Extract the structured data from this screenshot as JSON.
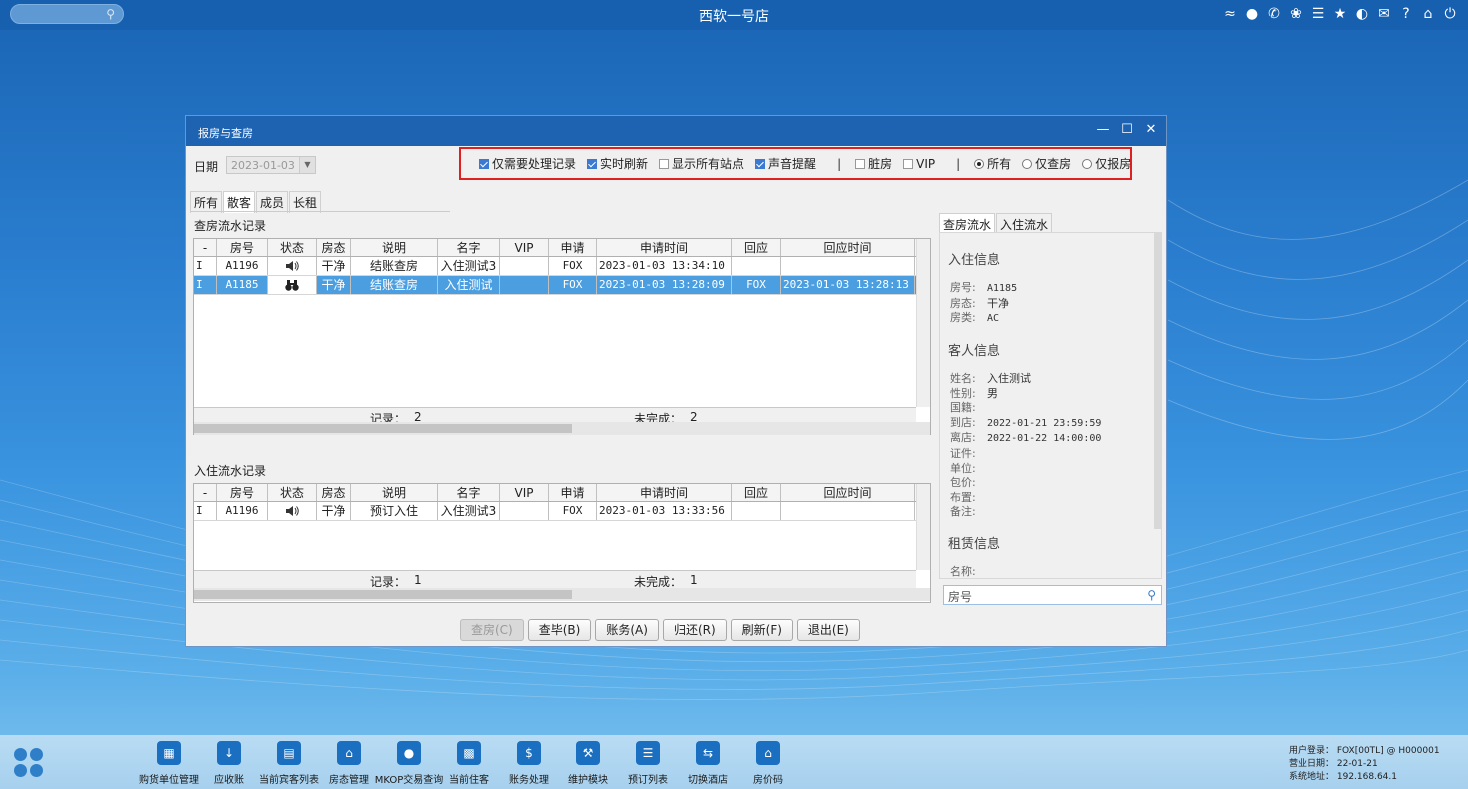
{
  "app_title": "西软一号店",
  "dialog": {
    "title": "报房与查房",
    "minimize": "—",
    "maximize": "☐",
    "close": "✕"
  },
  "date": {
    "label": "日期",
    "value": "2023-01-03"
  },
  "filters": {
    "only_pending": {
      "label": "仅需要处理记录",
      "checked": true
    },
    "realtime": {
      "label": "实时刷新",
      "checked": true
    },
    "all_stations": {
      "label": "显示所有站点",
      "checked": false
    },
    "sound": {
      "label": "声音提醒",
      "checked": true
    },
    "dirty": {
      "label": "脏房",
      "checked": false
    },
    "vip": {
      "label": "VIP",
      "checked": false
    },
    "sep": "|",
    "radio_all": {
      "label": "所有",
      "selected": true
    },
    "radio_check": {
      "label": "仅查房",
      "selected": false
    },
    "radio_report": {
      "label": "仅报房",
      "selected": false
    }
  },
  "tabs": [
    "所有",
    "散客",
    "成员",
    "长租"
  ],
  "inspect_section": {
    "label": "查房流水记录",
    "columns": [
      "-",
      "房号",
      "状态",
      "房态",
      "说明",
      "名字",
      "VIP",
      "申请",
      "申请时间",
      "回应",
      "回应时间"
    ],
    "rows": [
      {
        "flag": "I",
        "room": "A1196",
        "status_icon": "speaker-icon",
        "state": "干净",
        "desc": "结账查房",
        "name": "入住测试3",
        "vip": "",
        "apply": "FOX",
        "apply_time": "2023-01-03 13:34:10",
        "reply": "",
        "reply_time": ""
      },
      {
        "flag": "I",
        "room": "A1185",
        "status_icon": "binoculars-icon",
        "state": "干净",
        "desc": "结账查房",
        "name": "入住测试",
        "vip": "",
        "apply": "FOX",
        "apply_time": "2023-01-03 13:28:09",
        "reply": "FOX",
        "reply_time": "2023-01-03 13:28:13"
      }
    ],
    "footer": {
      "records_label": "记录：",
      "records": "2",
      "unfinished_label": "未完成：",
      "unfinished": "2"
    }
  },
  "checkin_section": {
    "label": "入住流水记录",
    "rows": [
      {
        "flag": "I",
        "room": "A1196",
        "status_icon": "speaker-icon",
        "state": "干净",
        "desc": "预订入住",
        "name": "入住测试3",
        "vip": "",
        "apply": "FOX",
        "apply_time": "2023-01-03 13:33:56",
        "reply": "",
        "reply_time": ""
      }
    ],
    "footer": {
      "records_label": "记录：",
      "records": "1",
      "unfinished_label": "未完成：",
      "unfinished": "1"
    }
  },
  "right_tabs": [
    "查房流水",
    "入住流水"
  ],
  "checkin_info": {
    "title": "入住信息",
    "fields": [
      {
        "k": "房号:",
        "v": "A1185"
      },
      {
        "k": "房态:",
        "v": "干净"
      },
      {
        "k": "房类:",
        "v": "AC"
      }
    ]
  },
  "guest_info": {
    "title": "客人信息",
    "fields": [
      {
        "k": "姓名:",
        "v": "入住测试"
      },
      {
        "k": "性别:",
        "v": "男"
      },
      {
        "k": "国籍:",
        "v": ""
      },
      {
        "k": "到店:",
        "v": "2022-01-21 23:59:59"
      },
      {
        "k": "离店:",
        "v": "2022-01-22 14:00:00"
      },
      {
        "k": "证件:",
        "v": ""
      },
      {
        "k": "单位:",
        "v": ""
      },
      {
        "k": "包价:",
        "v": ""
      },
      {
        "k": "布置:",
        "v": ""
      },
      {
        "k": "备注:",
        "v": ""
      }
    ]
  },
  "rent_info": {
    "title": "租赁信息",
    "fields": [
      {
        "k": "名称:",
        "v": ""
      }
    ]
  },
  "room_search": {
    "placeholder": "房号"
  },
  "buttons": {
    "inspect": "查房(C)",
    "finish": "查毕(B)",
    "account": "账务(A)",
    "return": "归还(R)",
    "refresh": "刷新(F)",
    "exit": "退出(E)"
  },
  "taskbar": [
    {
      "label": "购货单位管理",
      "icon": "building-icon"
    },
    {
      "label": "应收账",
      "icon": "download-icon"
    },
    {
      "label": "当前宾客列表",
      "icon": "guest-list-icon"
    },
    {
      "label": "房态管理",
      "icon": "house-icon"
    },
    {
      "label": "MKOP交易查询",
      "icon": "coin-icon"
    },
    {
      "label": "当前住客",
      "icon": "id-card-icon"
    },
    {
      "label": "账务处理",
      "icon": "money-icon"
    },
    {
      "label": "维护模块",
      "icon": "wrench-icon"
    },
    {
      "label": "预订列表",
      "icon": "booking-icon"
    },
    {
      "label": "切换酒店",
      "icon": "switch-icon"
    },
    {
      "label": "房价码",
      "icon": "home-icon"
    }
  ],
  "sysinfo": {
    "user": "用户登录：   FOX[00TL] @ H000001",
    "biz_date": "营业日期：   22-01-21",
    "sys_addr": "系统地址：   192.168.64.1"
  },
  "colors": {
    "accent": "#1d63b2",
    "selection": "#4b9ee0",
    "highlight_border": "#e02020"
  }
}
